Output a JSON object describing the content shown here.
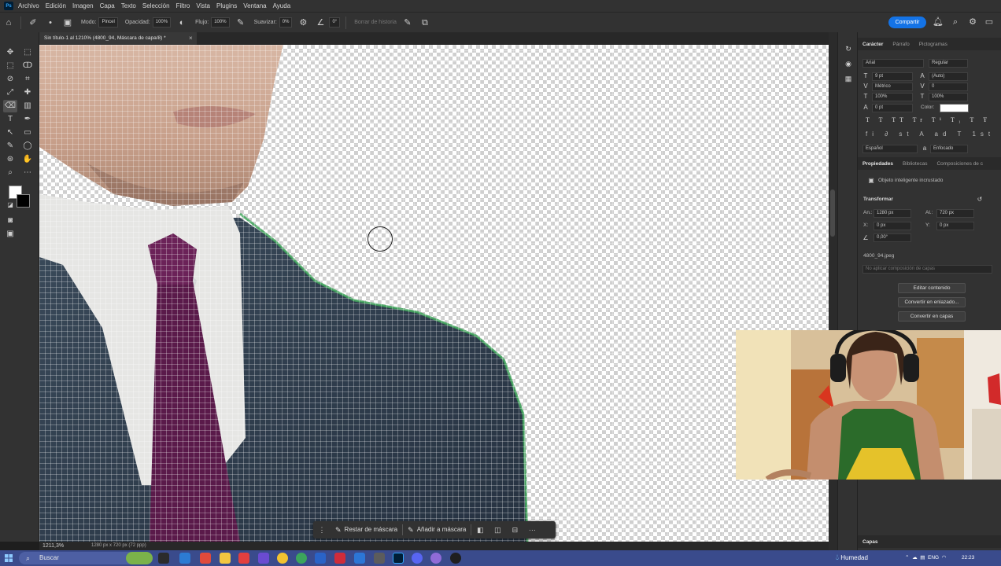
{
  "app": {
    "logo_text": "Ps"
  },
  "menu": [
    "Archivo",
    "Edición",
    "Imagen",
    "Capa",
    "Texto",
    "Selección",
    "Filtro",
    "Vista",
    "Plugins",
    "Ventana",
    "Ayuda"
  ],
  "options": {
    "mode_label": "Modo:",
    "mode_value": "Pincel",
    "opacity_label": "Opacidad:",
    "opacity_value": "100%",
    "flow_label": "Flujo:",
    "flow_value": "100%",
    "smoothing_label": "Suavizar:",
    "smoothing_value": "0%",
    "angle_value": "0°",
    "history_label": "Borrar de historia",
    "share_label": "Compartir"
  },
  "document": {
    "tab_title": "Sin título-1 al 1210% (4800_94, Máscara de capa/8) *",
    "close_glyph": "×"
  },
  "context_bar": {
    "subtract_label": "Restar de máscara",
    "add_label": "Añadir a máscara",
    "more_glyph": "···"
  },
  "status": {
    "zoom": "1211,3%",
    "doc_info": "1280 px x 720 px (72 ppp)"
  },
  "character_panel": {
    "tabs": [
      "Carácter",
      "Párrafo",
      "Pictogramas"
    ],
    "font_family": "Arial",
    "font_style": "Regular",
    "font_size": "9 pt",
    "leading": "(Auto)",
    "kerning": "Métrico",
    "tracking": "0",
    "vertical_scale": "100%",
    "horizontal_scale": "100%",
    "baseline": "0 pt",
    "color_label": "Color:",
    "language": "Español",
    "antialias": "Enfocado"
  },
  "properties_panel": {
    "tabs": [
      "Propiedades",
      "Bibliotecas",
      "Composiciones de c"
    ],
    "object_type": "Objeto inteligente incrustado",
    "transform_label": "Transformar",
    "width_label": "An.:",
    "width_value": "1280 px",
    "height_label": "Al.:",
    "height_value": "720 px",
    "x_label": "X:",
    "x_value": "0 px",
    "y_label": "Y:",
    "y_value": "0 px",
    "angle_value": "0,00°",
    "file_name": "4800_94.jpeg",
    "layer_comp_placeholder": "No aplicar composición de capas",
    "edit_contents": "Editar contenido",
    "convert_linked": "Convertir en enlazado...",
    "convert_layers": "Convertir en capas"
  },
  "layers_panel": {
    "title": "Capas"
  },
  "taskbar": {
    "search_label": "Buscar",
    "weather_label": "Humedad",
    "language": "ENG",
    "time": "22:23",
    "date": "..."
  },
  "colors": {
    "accent": "#1473e6",
    "panel_bg": "#323232",
    "taskbar_bg": "#3a4b8c",
    "suit": "#2b3846",
    "tie": "#5a1a4a"
  }
}
